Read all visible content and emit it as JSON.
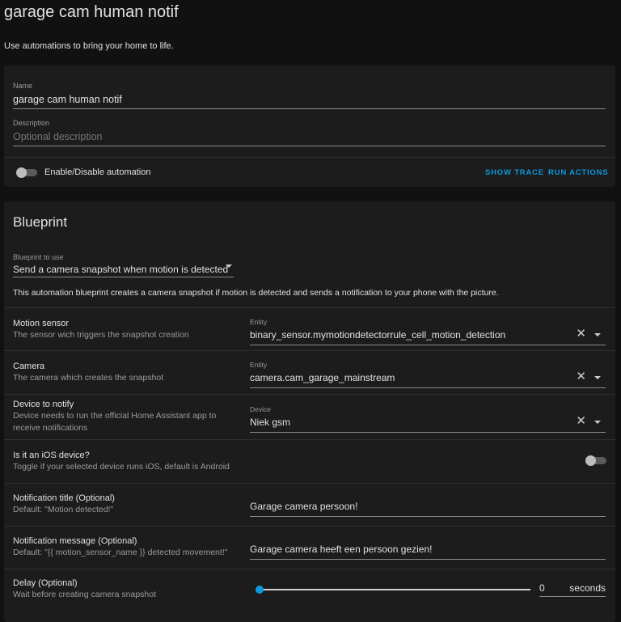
{
  "header": {
    "title": "garage cam human notif",
    "intro": "Use automations to bring your home to life."
  },
  "details": {
    "name_label": "Name",
    "name_value": "garage cam human notif",
    "description_label": "Description",
    "description_placeholder": "Optional description",
    "enable_label": "Enable/Disable automation",
    "enabled": false,
    "show_trace": "SHOW TRACE",
    "run_actions": "RUN ACTIONS"
  },
  "blueprint": {
    "heading": "Blueprint",
    "select_label": "Blueprint to use",
    "select_value": "Send a camera snapshot when motion is detected",
    "description": "This automation blueprint creates a camera snapshot if motion is detected and sends a notification to your phone with the picture.",
    "inputs": [
      {
        "label": "Motion sensor",
        "desc": "The sensor wich triggers the snapshot creation",
        "field_label": "Entity",
        "value": "binary_sensor.mymotiondetectorrule_cell_motion_detection"
      },
      {
        "label": "Camera",
        "desc": "The camera which creates the snapshot",
        "field_label": "Entity",
        "value": "camera.cam_garage_mainstream"
      },
      {
        "label": "Device to notify",
        "desc": "Device needs to run the official Home Assistant app to receive notifications",
        "field_label": "Device",
        "value": "Niek gsm"
      },
      {
        "label": "Is it an iOS device?",
        "desc": "Toggle if your selected device runs iOS, default is Android",
        "toggle": false
      },
      {
        "label": "Notification title (Optional)",
        "desc": "Default: \"Motion detected!\"",
        "value": "Garage camera persoon!"
      },
      {
        "label": "Notification message (Optional)",
        "desc": "Default: \"{{ motion_sensor_name }} detected movement!\"",
        "value": "Garage camera heeft een persoon gezien!"
      },
      {
        "label": "Delay (Optional)",
        "desc": "Wait before creating camera snapshot",
        "slider_value": "0",
        "slider_fraction": 0,
        "unit": "seconds"
      }
    ]
  },
  "colors": {
    "accent": "#0d99e0",
    "card": "#1c1c1c",
    "background": "#111111"
  }
}
